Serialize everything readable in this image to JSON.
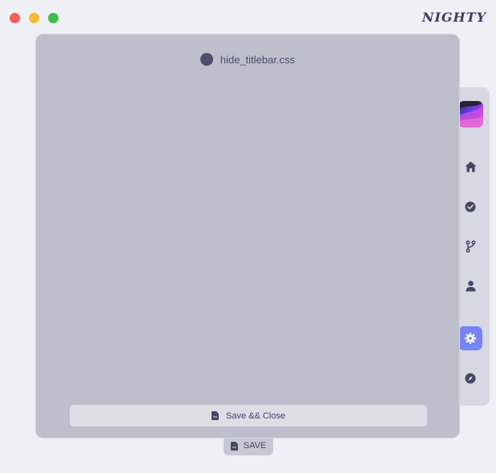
{
  "window": {
    "controls": [
      {
        "name": "close",
        "color": "#f26057"
      },
      {
        "name": "minimize",
        "color": "#f5bb33"
      },
      {
        "name": "maximize",
        "color": "#3ebe4a"
      }
    ],
    "brand": "NIGHTY"
  },
  "sidebar": {
    "items": [
      {
        "icon": "home-icon"
      },
      {
        "icon": "check-circle-icon"
      },
      {
        "icon": "git-branch-icon"
      },
      {
        "icon": "user-icon"
      },
      {
        "icon": "gear-icon",
        "active": true
      },
      {
        "icon": "compass-icon"
      }
    ],
    "accent": "#7783f6"
  },
  "modal": {
    "filename": "hide_titlebar.css",
    "footer_button": "Save && Close"
  },
  "save_button": {
    "label": "SAVE"
  }
}
